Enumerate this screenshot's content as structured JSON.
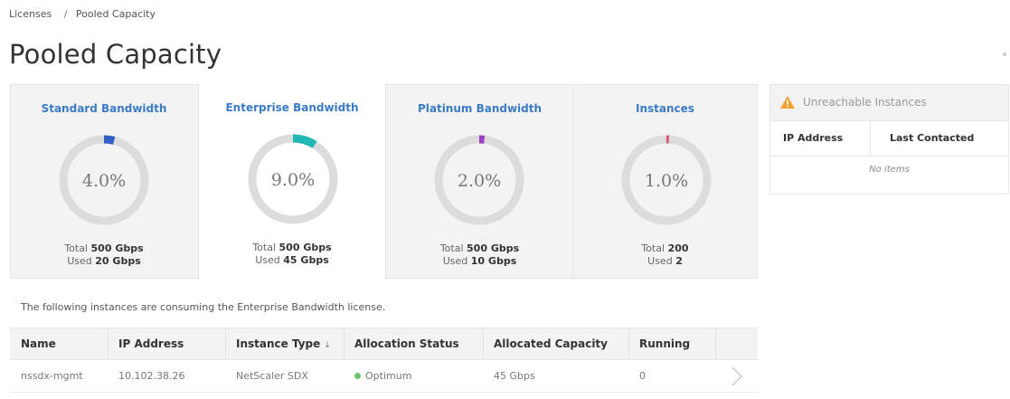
{
  "breadcrumb": {
    "parent": "Licenses",
    "separator": "/",
    "current": "Pooled Capacity"
  },
  "page": {
    "title": "Pooled Capacity"
  },
  "tiles": [
    {
      "title": "Standard Bandwidth",
      "percent_label": "4.0%",
      "fraction": 0.04,
      "color": "#2f5fc4",
      "total_label": "Total",
      "total_value": "500 Gbps",
      "used_label": "Used",
      "used_value": "20 Gbps",
      "selected": false
    },
    {
      "title": "Enterprise Bandwidth",
      "percent_label": "9.0%",
      "fraction": 0.09,
      "color": "#21b7b5",
      "total_label": "Total",
      "total_value": "500 Gbps",
      "used_label": "Used",
      "used_value": "45 Gbps",
      "selected": true
    },
    {
      "title": "Platinum Bandwidth",
      "percent_label": "2.0%",
      "fraction": 0.02,
      "color": "#9b3ec2",
      "total_label": "Total",
      "total_value": "500 Gbps",
      "used_label": "Used",
      "used_value": "10 Gbps",
      "selected": false
    },
    {
      "title": "Instances",
      "percent_label": "1.0%",
      "fraction": 0.01,
      "color": "#e0557a",
      "total_label": "Total",
      "total_value": "200",
      "used_label": "Used",
      "used_value": "2",
      "selected": false
    }
  ],
  "consumption_note": "The following instances are consuming the Enterprise Bandwidth license.",
  "table": {
    "columns": [
      "Name",
      "IP Address",
      "Instance Type",
      "Allocation Status",
      "Allocated Capacity",
      "Running"
    ],
    "rows": [
      {
        "name": "nssdx-mgmt",
        "ip": "10.102.38.26",
        "type": "NetScaler SDX",
        "status": "Optimum",
        "status_color": "#6cc36c",
        "capacity": "45 Gbps",
        "running": "0"
      }
    ]
  },
  "unreachable": {
    "title": "Unreachable Instances",
    "icon": "warning-triangle-icon",
    "icon_color": "#f0a030",
    "columns": [
      "IP Address",
      "Last Contacted"
    ],
    "empty_text": "No items"
  }
}
